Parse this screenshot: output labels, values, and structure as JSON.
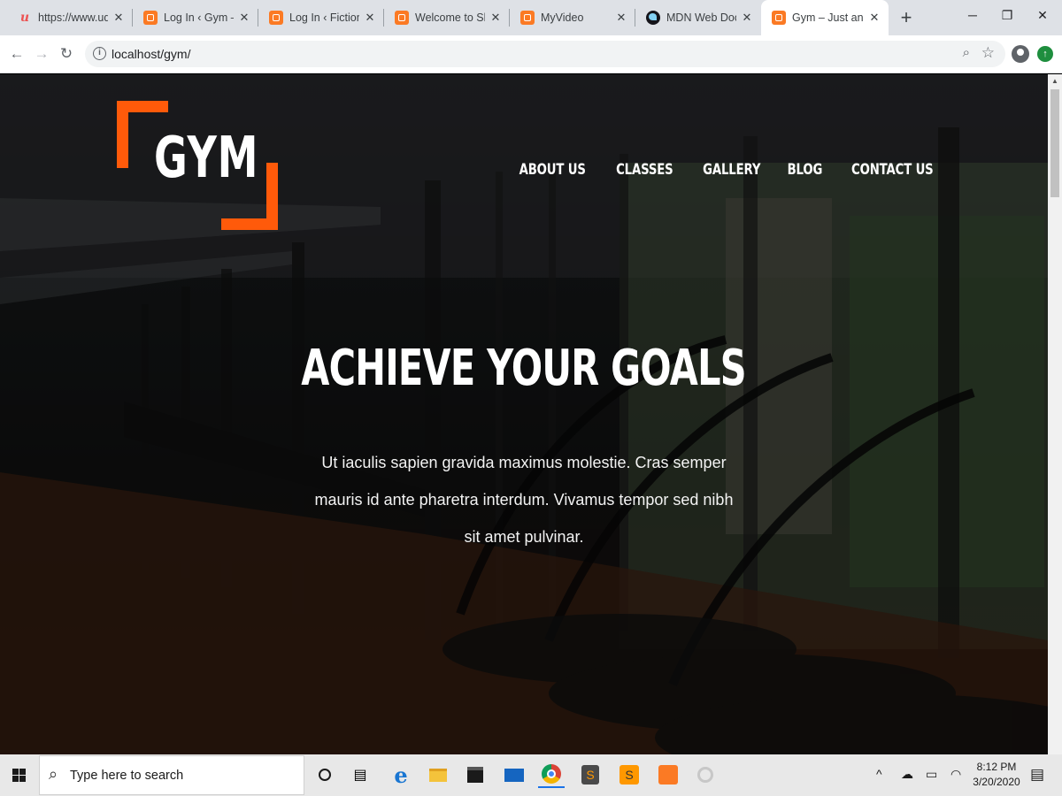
{
  "browser": {
    "tabs": [
      {
        "title": "https://www.udemy",
        "favicon": "udemy-icon"
      },
      {
        "title": "Log In ‹ Gym — W",
        "favicon": "xampp-icon"
      },
      {
        "title": "Log In ‹ Fictional U",
        "favicon": "xampp-icon"
      },
      {
        "title": "Welcome to Slotify",
        "favicon": "xampp-icon"
      },
      {
        "title": "MyVideo",
        "favicon": "xampp-icon"
      },
      {
        "title": "MDN Web Docs",
        "favicon": "mdn-icon"
      },
      {
        "title": "Gym – Just anothe",
        "favicon": "xampp-icon",
        "active": true
      }
    ],
    "url": "localhost/gym/"
  },
  "site": {
    "logo_text": "GYM",
    "accent_color": "#ff5a0a",
    "nav": [
      "ABOUT US",
      "CLASSES",
      "GALLERY",
      "BLOG",
      "CONTACT US"
    ],
    "hero_title": "ACHIEVE YOUR GOALS",
    "hero_text": "Ut iaculis sapien gravida maximus molestie. Cras semper mauris id ante pharetra interdum. Vivamus tempor sed nibh sit amet pulvinar."
  },
  "taskbar": {
    "search_placeholder": "Type here to search",
    "time": "8:12 PM",
    "date": "3/20/2020"
  }
}
